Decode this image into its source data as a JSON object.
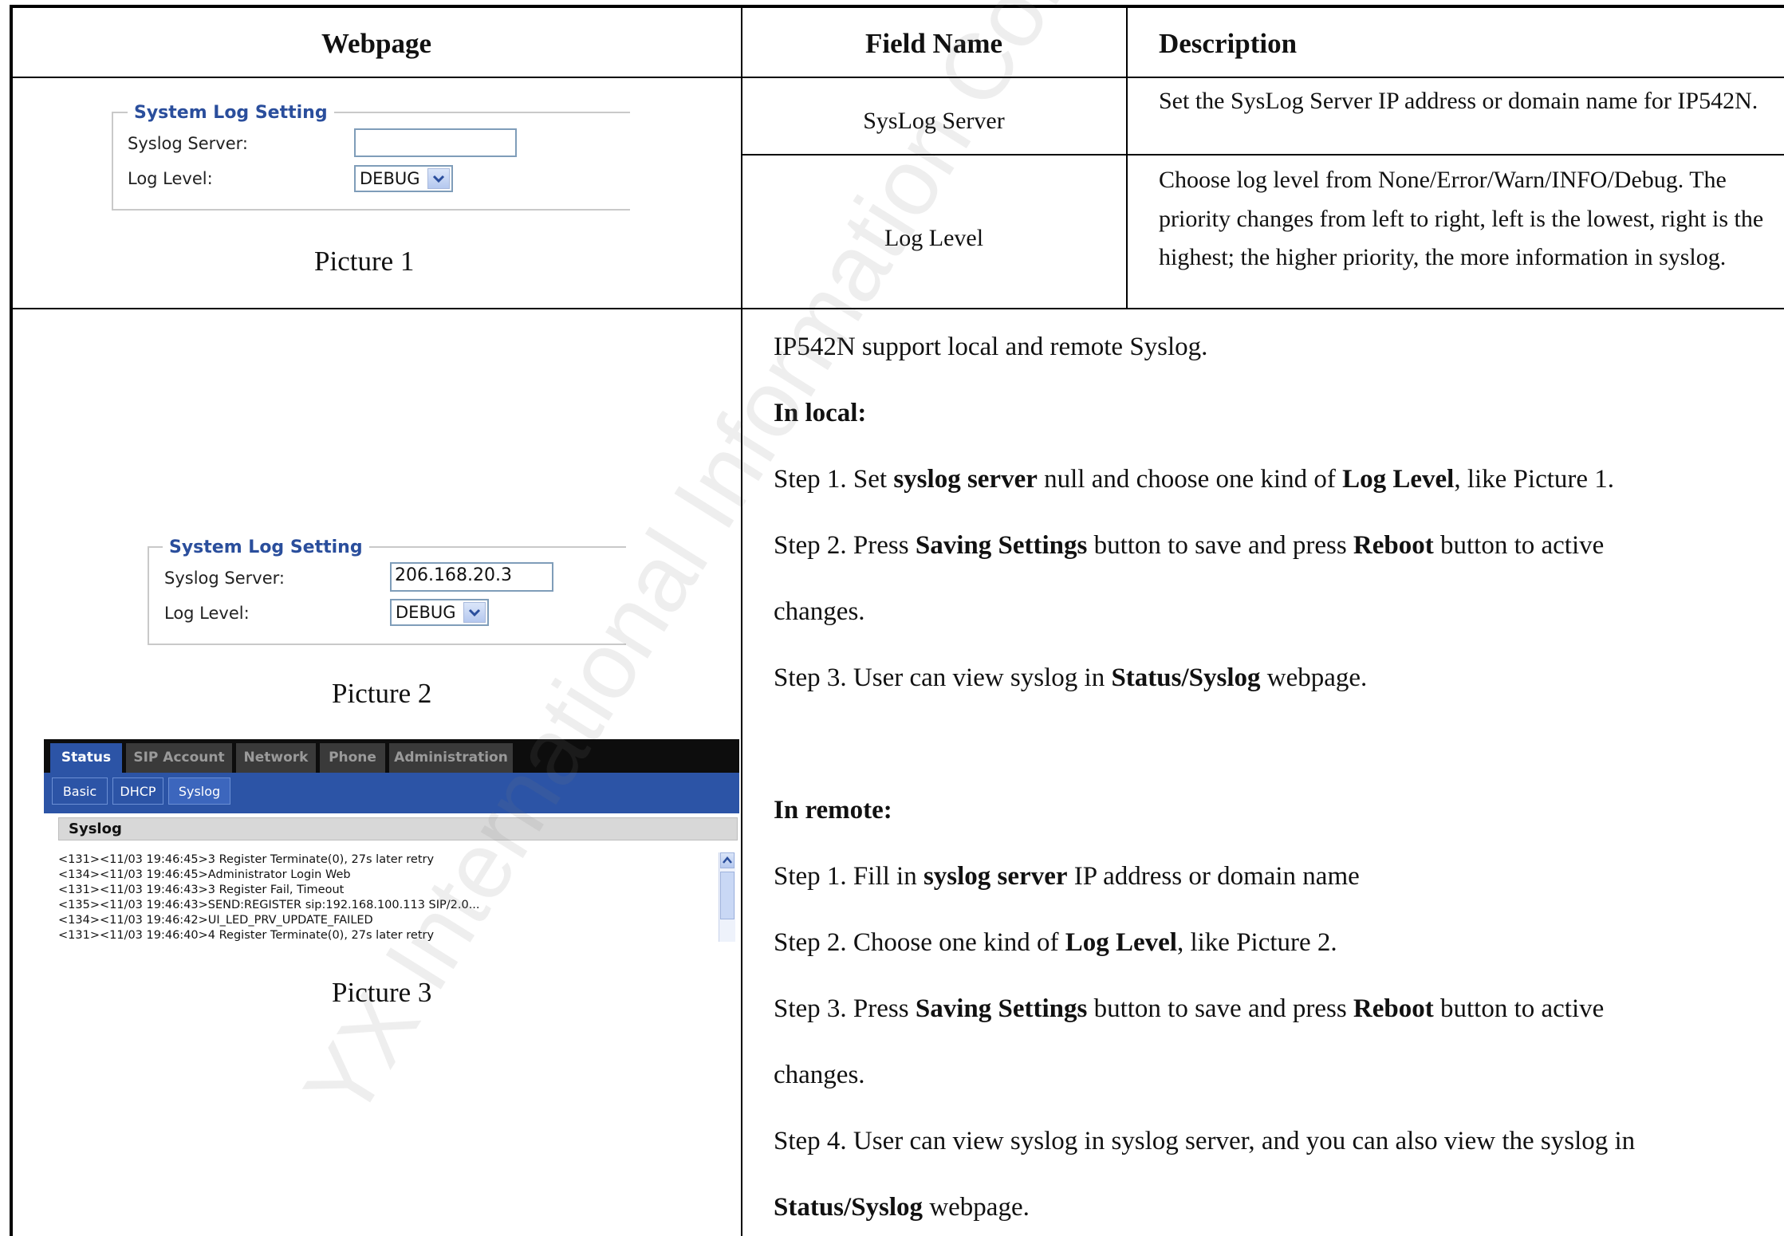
{
  "table": {
    "headers": {
      "webpage": "Webpage",
      "field_name": "Field Name",
      "description": "Description"
    },
    "rows": [
      {
        "field": "SysLog Server",
        "description": "Set the SysLog Server IP address or domain name for IP542N."
      },
      {
        "field": "Log Level",
        "description": "Choose log level from None/Error/Warn/INFO/Debug. The priority changes from left to right, left is the lowest, right is the highest; the higher priority, the more information in syslog."
      }
    ]
  },
  "picture1": {
    "legend": "System Log Setting",
    "syslog_label": "Syslog Server:",
    "syslog_value": "",
    "loglevel_label": "Log Level:",
    "loglevel_value": "DEBUG",
    "caption": "Picture 1"
  },
  "picture2": {
    "legend": "System Log Setting",
    "syslog_label": "Syslog Server:",
    "syslog_value": "206.168.20.3",
    "loglevel_label": "Log Level:",
    "loglevel_value": "DEBUG",
    "caption": "Picture 2"
  },
  "picture3": {
    "tabs": [
      "Status",
      "SIP Account",
      "Network",
      "Phone",
      "Administration"
    ],
    "subtabs": [
      "Basic",
      "DHCP",
      "Syslog"
    ],
    "section_title": "Syslog",
    "log_lines": [
      "<131><11/03 19:46:45>3 Register Terminate(0), 27s later retry",
      "<134><11/03 19:46:45>Administrator Login Web",
      "<131><11/03 19:46:43>3 Register Fail, Timeout",
      "<135><11/03 19:46:43>SEND:REGISTER sip:192.168.100.113 SIP/2.0...",
      "<134><11/03 19:46:42>UI_LED_PRV_UPDATE_FAILED",
      "<131><11/03 19:46:40>4 Register Terminate(0), 27s later retry"
    ],
    "caption": "Picture 3"
  },
  "instructions": {
    "intro": "IP542N support local and remote Syslog.",
    "local_heading": "In local:",
    "local": {
      "s1_a": "Step 1. Set ",
      "s1_b": "syslog server",
      "s1_c": " null and choose one kind of ",
      "s1_d": "Log Level",
      "s1_e": ", like Picture 1.",
      "s2_a": "Step 2. Press ",
      "s2_b": "Saving Settings",
      "s2_c": " button to save and press ",
      "s2_d": "Reboot",
      "s2_e": " button to active",
      "s2_f": "changes.",
      "s3_a": "Step 3. User can view syslog in ",
      "s3_b": "Status/Syslog",
      "s3_c": " webpage."
    },
    "remote_heading": "In remote:",
    "remote": {
      "s1_a": "Step 1. Fill in ",
      "s1_b": "syslog server",
      "s1_c": " IP address or domain name",
      "s2_a": "Step 2. Choose one kind of ",
      "s2_b": "Log Level",
      "s2_c": ", like Picture 2.",
      "s3_a": "Step 3. Press ",
      "s3_b": "Saving Settings",
      "s3_c": " button to save and press ",
      "s3_d": "Reboot",
      "s3_e": " button to active",
      "s3_f": "changes.",
      "s4_a": "Step 4. User can view syslog in syslog server, and you can also view the syslog in",
      "s4_b": "Status/Syslog",
      "s4_c": " webpage."
    }
  },
  "watermark": "YX International Information Co.,Ltd"
}
